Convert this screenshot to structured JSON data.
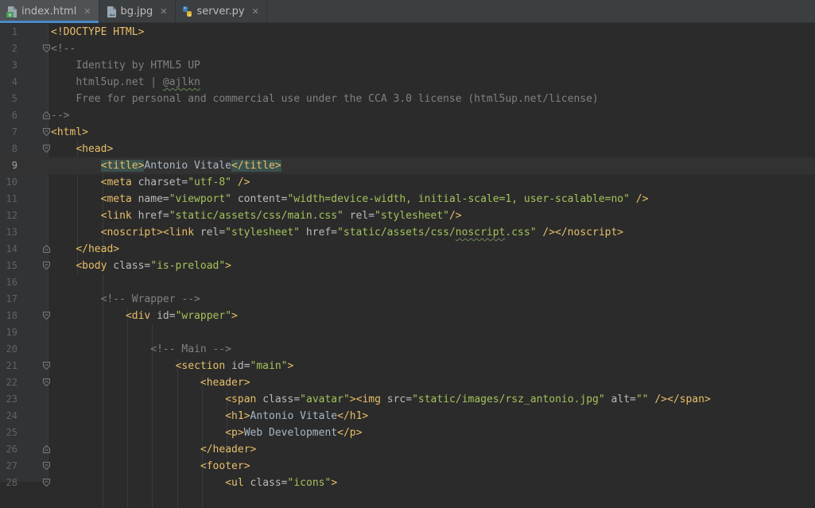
{
  "tabs": [
    {
      "label": "index.html",
      "icon": "html-file-icon",
      "active": true
    },
    {
      "label": "bg.jpg",
      "icon": "image-file-icon",
      "active": false
    },
    {
      "label": "server.py",
      "icon": "python-file-icon",
      "active": false
    }
  ],
  "close_glyph": "✕",
  "current_line": 9,
  "lines": [
    {
      "n": "1",
      "fold": "",
      "indent": 0,
      "tokens": [
        [
          "doc",
          "<!DOCTYPE HTML>"
        ]
      ]
    },
    {
      "n": "2",
      "fold": "open",
      "indent": 0,
      "tokens": [
        [
          "com",
          "<!--"
        ]
      ]
    },
    {
      "n": "3",
      "fold": "",
      "indent": 4,
      "tokens": [
        [
          "com",
          "Identity by HTML5 UP"
        ]
      ]
    },
    {
      "n": "4",
      "fold": "",
      "indent": 4,
      "tokens": [
        [
          "com",
          "html5up.net | "
        ],
        [
          "comwavy",
          "@ajlkn"
        ]
      ]
    },
    {
      "n": "5",
      "fold": "",
      "indent": 4,
      "tokens": [
        [
          "com",
          "Free for personal and commercial use under the CCA 3.0 license (html5up.net/license)"
        ]
      ]
    },
    {
      "n": "6",
      "fold": "close",
      "indent": 0,
      "tokens": [
        [
          "com",
          "-->"
        ]
      ]
    },
    {
      "n": "7",
      "fold": "open",
      "indent": 0,
      "tokens": [
        [
          "tag",
          "<html>"
        ]
      ]
    },
    {
      "n": "8",
      "fold": "open",
      "indent": 4,
      "tokens": [
        [
          "tag",
          "<head>"
        ]
      ]
    },
    {
      "n": "9",
      "fold": "",
      "indent": 8,
      "tokens": [
        [
          "taghl",
          "<title>"
        ],
        [
          "txt",
          "Antonio Vitale"
        ],
        [
          "taghl",
          "</title>"
        ]
      ]
    },
    {
      "n": "10",
      "fold": "",
      "indent": 8,
      "tokens": [
        [
          "tag",
          "<meta "
        ],
        [
          "attr",
          "charset="
        ],
        [
          "val",
          "\"utf-8\""
        ],
        [
          "tag",
          " />"
        ]
      ]
    },
    {
      "n": "11",
      "fold": "",
      "indent": 8,
      "tokens": [
        [
          "tag",
          "<meta "
        ],
        [
          "attr",
          "name="
        ],
        [
          "val",
          "\"viewport\""
        ],
        [
          "attr",
          " content="
        ],
        [
          "val",
          "\"width=device-width, initial-scale=1, user-scalable=no\""
        ],
        [
          "tag",
          " />"
        ]
      ]
    },
    {
      "n": "12",
      "fold": "",
      "indent": 8,
      "tokens": [
        [
          "tag",
          "<link "
        ],
        [
          "attr",
          "href="
        ],
        [
          "val",
          "\"static/assets/css/main.css\""
        ],
        [
          "attr",
          " rel="
        ],
        [
          "val",
          "\"stylesheet\""
        ],
        [
          "tag",
          "/>"
        ]
      ]
    },
    {
      "n": "13",
      "fold": "",
      "indent": 8,
      "tokens": [
        [
          "tag",
          "<noscript><link "
        ],
        [
          "attr",
          "rel="
        ],
        [
          "val",
          "\"stylesheet\""
        ],
        [
          "attr",
          " href="
        ],
        [
          "val",
          "\"static/assets/css/"
        ],
        [
          "valwavy",
          "noscript"
        ],
        [
          "val",
          ".css\""
        ],
        [
          "tag",
          " /></noscript>"
        ]
      ]
    },
    {
      "n": "14",
      "fold": "close",
      "indent": 4,
      "tokens": [
        [
          "tag",
          "</head>"
        ]
      ]
    },
    {
      "n": "15",
      "fold": "open",
      "indent": 4,
      "tokens": [
        [
          "tag",
          "<body "
        ],
        [
          "attr",
          "class="
        ],
        [
          "val",
          "\"is-preload\""
        ],
        [
          "tag",
          ">"
        ]
      ]
    },
    {
      "n": "16",
      "fold": "",
      "indent": 0,
      "tokens": []
    },
    {
      "n": "17",
      "fold": "",
      "indent": 8,
      "tokens": [
        [
          "com",
          "<!-- Wrapper -->"
        ]
      ]
    },
    {
      "n": "18",
      "fold": "open",
      "indent": 12,
      "tokens": [
        [
          "tag",
          "<div "
        ],
        [
          "attr",
          "id="
        ],
        [
          "val",
          "\"wrapper\""
        ],
        [
          "tag",
          ">"
        ]
      ]
    },
    {
      "n": "19",
      "fold": "",
      "indent": 0,
      "tokens": []
    },
    {
      "n": "20",
      "fold": "",
      "indent": 16,
      "tokens": [
        [
          "com",
          "<!-- Main -->"
        ]
      ]
    },
    {
      "n": "21",
      "fold": "open",
      "indent": 20,
      "tokens": [
        [
          "tag",
          "<section "
        ],
        [
          "attr",
          "id="
        ],
        [
          "val",
          "\"main\""
        ],
        [
          "tag",
          ">"
        ]
      ]
    },
    {
      "n": "22",
      "fold": "open",
      "indent": 24,
      "tokens": [
        [
          "tag",
          "<header>"
        ]
      ]
    },
    {
      "n": "23",
      "fold": "",
      "indent": 28,
      "tokens": [
        [
          "tag",
          "<span "
        ],
        [
          "attr",
          "class="
        ],
        [
          "val",
          "\"avatar\""
        ],
        [
          "tag",
          ">"
        ],
        [
          "tag",
          "<img "
        ],
        [
          "attr",
          "src="
        ],
        [
          "val",
          "\"static/images/rsz_antonio.jpg\""
        ],
        [
          "attr",
          " alt="
        ],
        [
          "val",
          "\"\""
        ],
        [
          "tag",
          " /></span>"
        ]
      ]
    },
    {
      "n": "24",
      "fold": "",
      "indent": 28,
      "tokens": [
        [
          "tag",
          "<h1>"
        ],
        [
          "txt",
          "Antonio Vitale"
        ],
        [
          "tag",
          "</h1>"
        ]
      ]
    },
    {
      "n": "25",
      "fold": "",
      "indent": 28,
      "tokens": [
        [
          "tag",
          "<p>"
        ],
        [
          "txt",
          "Web Development"
        ],
        [
          "tag",
          "</p>"
        ]
      ]
    },
    {
      "n": "26",
      "fold": "close",
      "indent": 24,
      "tokens": [
        [
          "tag",
          "</header>"
        ]
      ]
    },
    {
      "n": "27",
      "fold": "open",
      "indent": 24,
      "tokens": [
        [
          "tag",
          "<footer>"
        ]
      ]
    },
    {
      "n": "28",
      "fold": "open",
      "indent": 28,
      "tokens": [
        [
          "tag",
          "<ul "
        ],
        [
          "attr",
          "class="
        ],
        [
          "val",
          "\"icons\""
        ],
        [
          "tag",
          ">"
        ]
      ]
    }
  ]
}
